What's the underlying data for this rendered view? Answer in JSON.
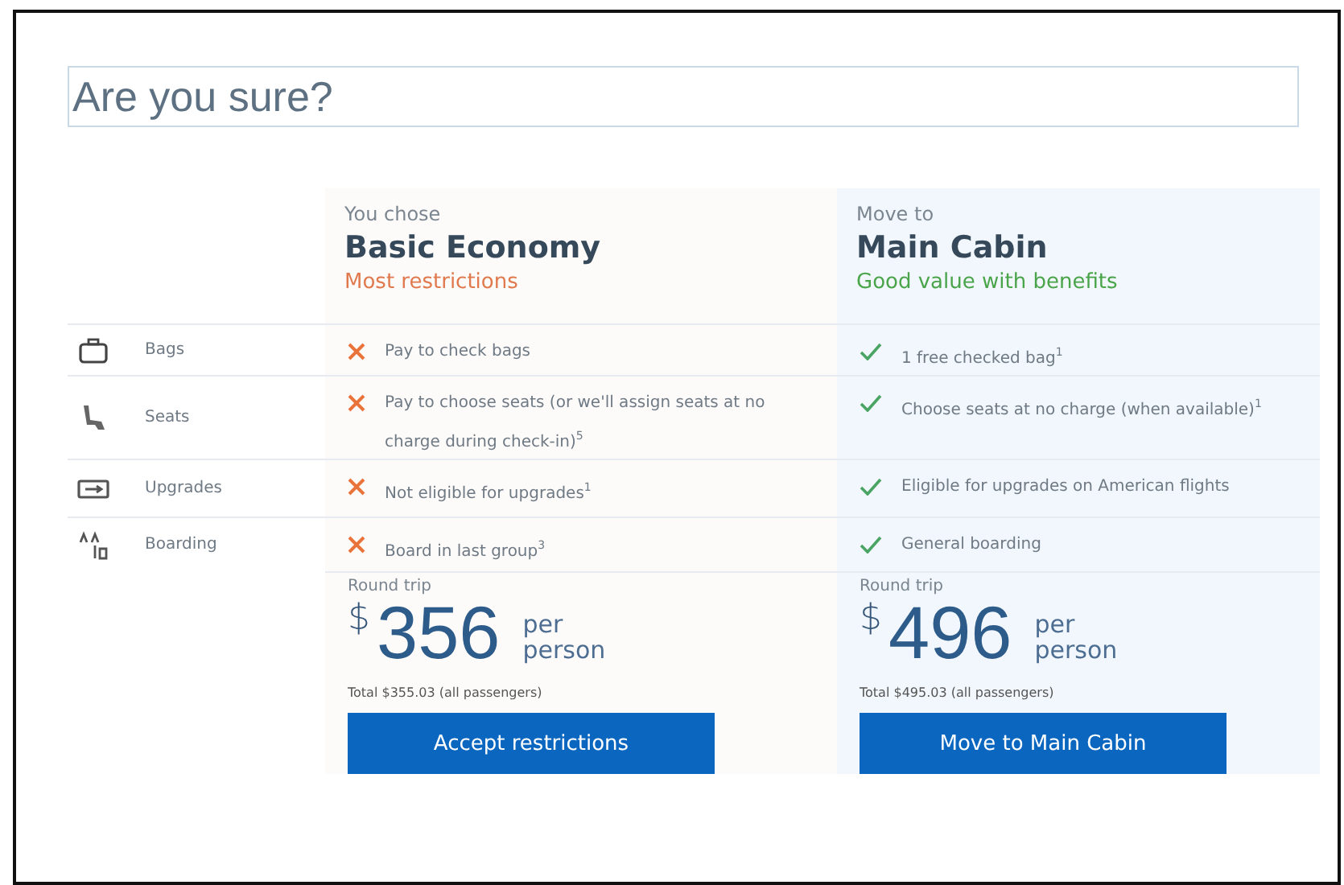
{
  "title": "Are you sure?",
  "options": [
    {
      "kicker": "You chose",
      "name": "Basic Economy",
      "tagline": "Most restrictions",
      "kind": "restricted",
      "trip": "Round trip",
      "currency": "$",
      "price": "356",
      "per": "per",
      "person": "person",
      "total": "Total $355.03 (all passengers)",
      "button": "Accept restrictions"
    },
    {
      "kicker": "Move to",
      "name": "Main Cabin",
      "tagline": "Good value with benefits",
      "kind": "benefit",
      "trip": "Round trip",
      "currency": "$",
      "price": "496",
      "per": "per",
      "person": "person",
      "total": "Total $495.03 (all passengers)",
      "button": "Move to Main Cabin"
    }
  ],
  "rows": [
    {
      "kind": "bag",
      "label": "Bags",
      "cells": [
        {
          "kind": "cross",
          "text": "Pay to check bags"
        },
        {
          "kind": "check",
          "text": "1 free checked bag$^{1}$"
        }
      ]
    },
    {
      "kind": "seat",
      "label": "Seats",
      "cells": [
        {
          "kind": "cross",
          "text": "Pay to choose seats (or we'll assign seats at no charge during check-in)$^{5}$"
        },
        {
          "kind": "check",
          "text": "Choose seats at no charge (when available)$^{1}$"
        }
      ]
    },
    {
      "kind": "ticket",
      "label": "Upgrades",
      "cells": [
        {
          "kind": "cross",
          "text": "Not eligible for upgrades$^{1}$"
        },
        {
          "kind": "check",
          "text": "Eligible for upgrades on American flights"
        }
      ]
    },
    {
      "kind": "boarding",
      "label": "Boarding",
      "cells": [
        {
          "kind": "cross",
          "text": "Board in last group$^{3}$"
        },
        {
          "kind": "check",
          "text": "General boarding"
        }
      ]
    }
  ]
}
